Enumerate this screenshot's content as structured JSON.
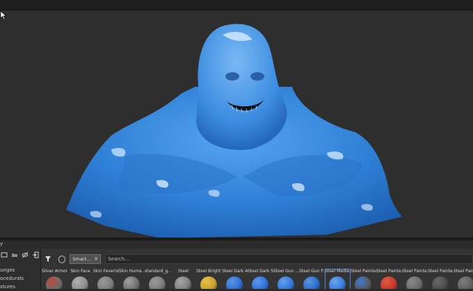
{
  "shelf": {
    "header_label": "y",
    "tools": [
      {
        "icon": "new-folder-icon"
      },
      {
        "icon": "folder-icon"
      },
      {
        "icon": "visibility-icon"
      },
      {
        "icon": "import-icon"
      }
    ],
    "categories": [
      "unges",
      "ocedurals",
      "xtures"
    ],
    "filter_tag": "Smart...",
    "search_placeholder": "Search...",
    "materials": [
      {
        "label": "Silver Armor",
        "color": "#6a6a6a",
        "accent": "#c24a3a"
      },
      {
        "label": "Skin Face",
        "color": "#8e8e8e",
        "accent": "#b0b0b0"
      },
      {
        "label": "Skin Feverish",
        "color": "#7c7c7c",
        "accent": "#9a9a9a"
      },
      {
        "label": "Skin Huma...",
        "color": "#6f6f6f",
        "accent": "#a0a0a0"
      },
      {
        "label": "standard_g...",
        "color": "#7a7a7a",
        "accent": "#9c9c9c"
      },
      {
        "label": "Steel",
        "color": "#7d7d7d",
        "accent": "#a8a8a8"
      },
      {
        "label": "Steel Bright ...",
        "color": "#c8a030",
        "accent": "#e6c04a"
      },
      {
        "label": "Steel Dark A...",
        "color": "#2f6fd0",
        "accent": "#5a95e6"
      },
      {
        "label": "Steel Dark S...",
        "color": "#2f72d6",
        "accent": "#5c98ea"
      },
      {
        "label": "Steel Gun ...",
        "color": "#3476d8",
        "accent": "#63a0ee"
      },
      {
        "label": "Steel Gun P...",
        "color": "#2b6cc8",
        "accent": "#5a93e0"
      },
      {
        "label": "Steel Medie...",
        "color": "#3a7ad8",
        "accent": "#6aa6f0"
      },
      {
        "label": "Steel Painted",
        "color": "#5a5a5a",
        "accent": "#3a7ad8"
      },
      {
        "label": "Steel Painte...",
        "color": "#c23a2a",
        "accent": "#e05a45"
      },
      {
        "label": "Steel Painte...",
        "color": "#6a6a6a",
        "accent": "#8a8a8a"
      },
      {
        "label": "Steel Painte...",
        "color": "#4a4a4a",
        "accent": "#6a6a6a"
      },
      {
        "label": "Steel Painte...",
        "color": "#5e5e5e",
        "accent": "#7e7e7e"
      }
    ],
    "selected_index": 11
  },
  "colors": {
    "viewport_bg": "#2e2e2e",
    "model_blue": "#3a8be0",
    "selection_blue": "#4a86d8"
  }
}
